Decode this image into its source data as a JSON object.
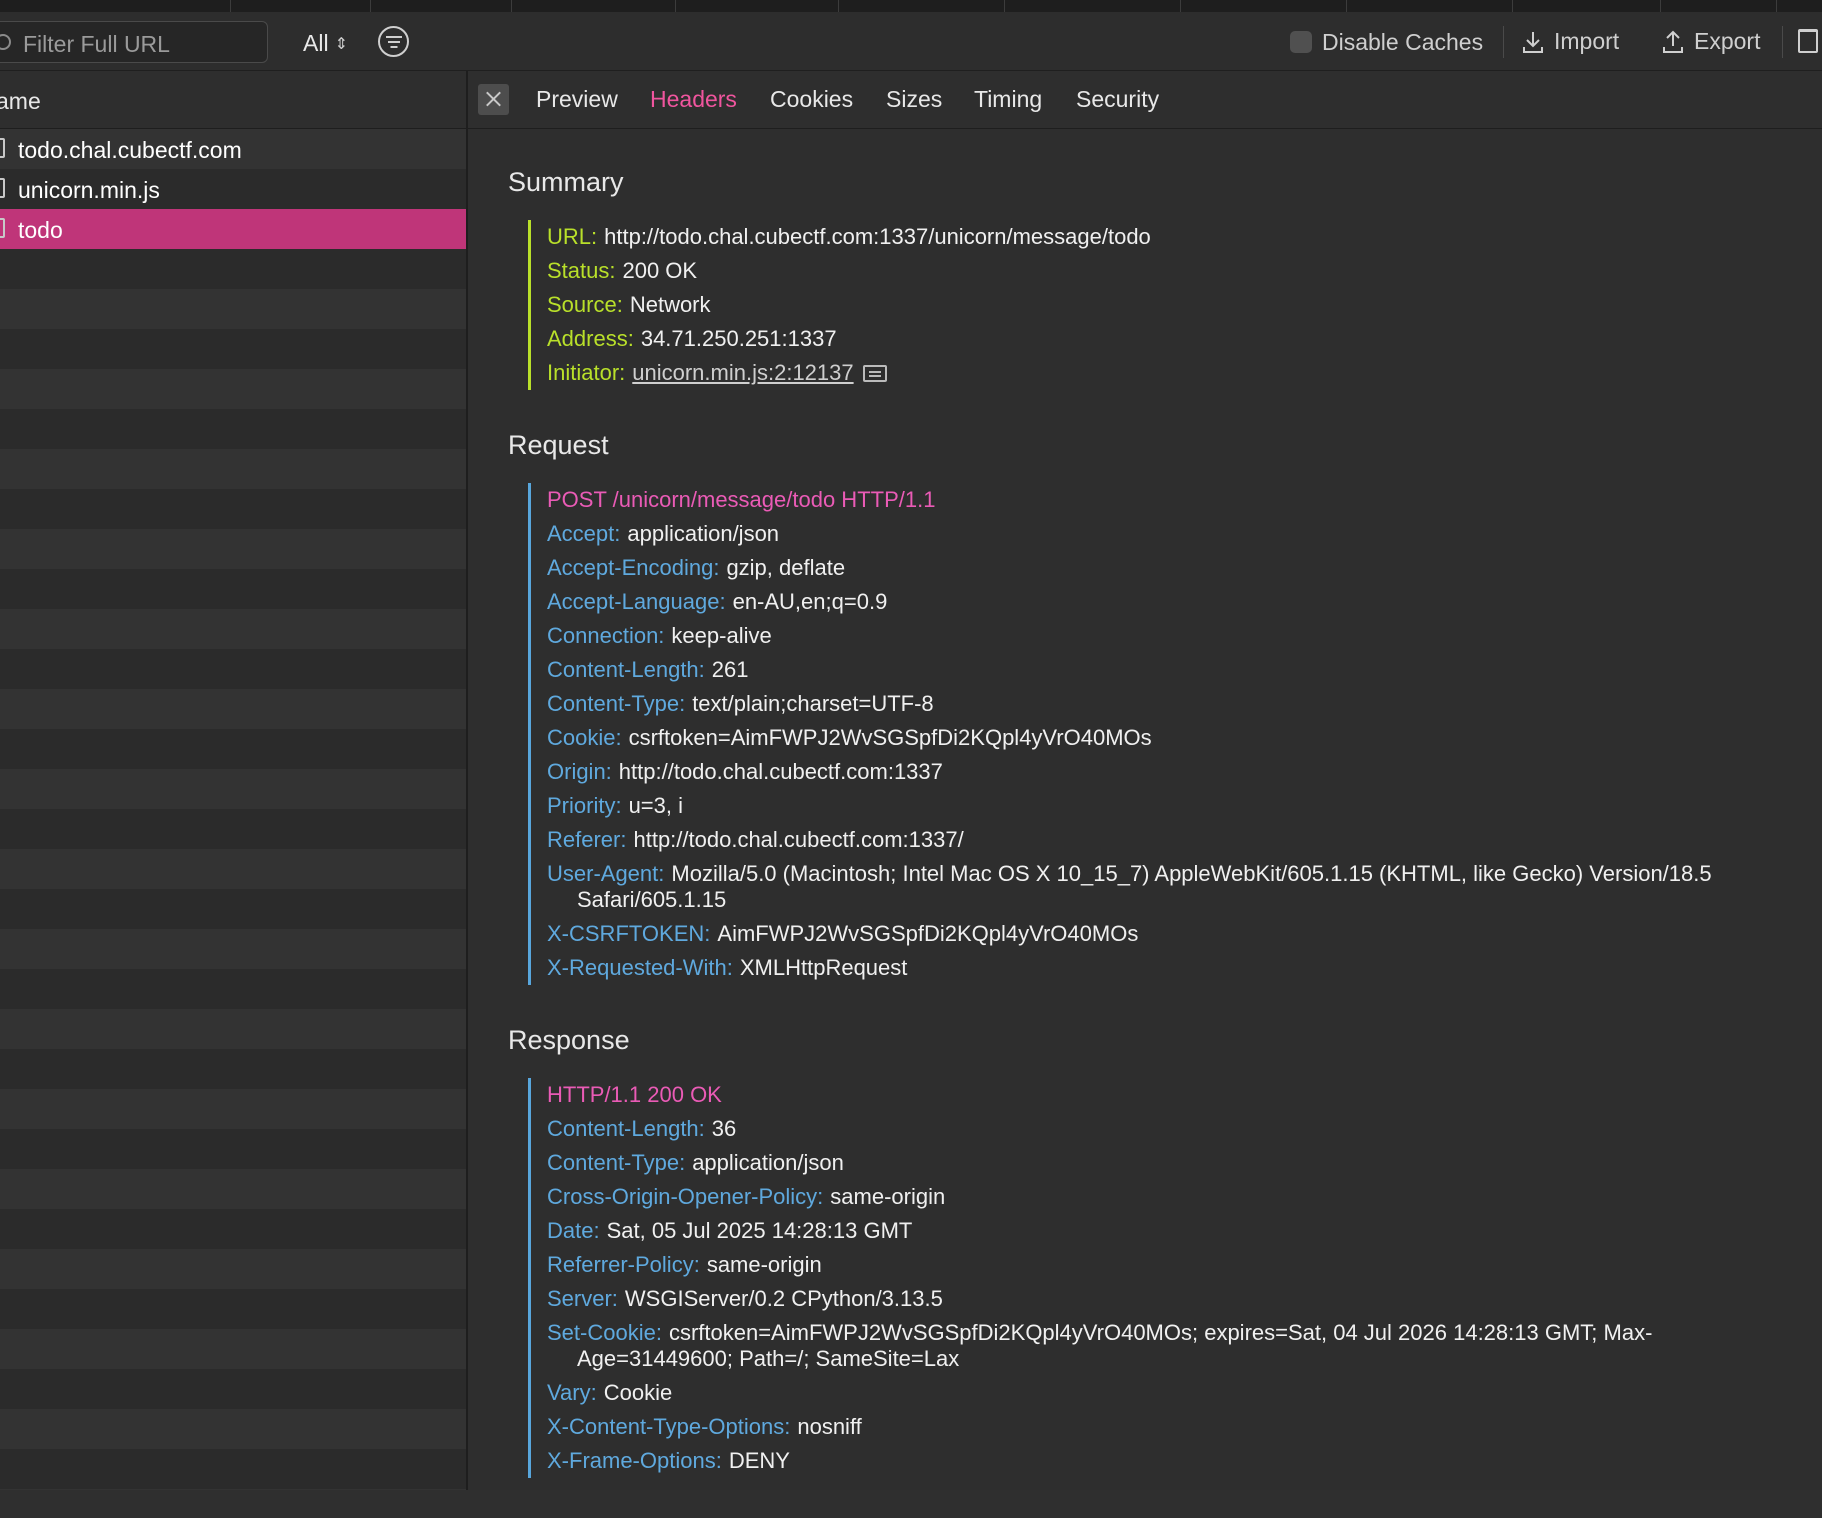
{
  "toolbar": {
    "filter_placeholder": "Filter Full URL",
    "type_select": "All",
    "disable_caches_label": "Disable Caches",
    "disable_caches_checked": false,
    "import_label": "Import",
    "export_label": "Export"
  },
  "list": {
    "header": "ame",
    "rows": [
      {
        "label": "todo.chal.cubectf.com",
        "selected": false
      },
      {
        "label": "unicorn.min.js",
        "selected": false
      },
      {
        "label": "todo",
        "selected": true
      }
    ]
  },
  "tabs": [
    "Preview",
    "Headers",
    "Cookies",
    "Sizes",
    "Timing",
    "Security"
  ],
  "active_tab": "Headers",
  "summary": {
    "title": "Summary",
    "url_key": "URL:",
    "url": "http://todo.chal.cubectf.com:1337/unicorn/message/todo",
    "status_key": "Status:",
    "status": "200 OK",
    "source_key": "Source:",
    "source": "Network",
    "address_key": "Address:",
    "address": "34.71.250.251:1337",
    "initiator_key": "Initiator:",
    "initiator": "unicorn.min.js:2:12137"
  },
  "request": {
    "title": "Request",
    "line": "POST /unicorn/message/todo HTTP/1.1",
    "headers": [
      {
        "key": "Accept:",
        "value": "application/json"
      },
      {
        "key": "Accept-Encoding:",
        "value": "gzip, deflate"
      },
      {
        "key": "Accept-Language:",
        "value": "en-AU,en;q=0.9"
      },
      {
        "key": "Connection:",
        "value": "keep-alive"
      },
      {
        "key": "Content-Length:",
        "value": "261"
      },
      {
        "key": "Content-Type:",
        "value": "text/plain;charset=UTF-8"
      },
      {
        "key": "Cookie:",
        "value": "csrftoken=AimFWPJ2WvSGSpfDi2KQpl4yVrO40MOs"
      },
      {
        "key": "Origin:",
        "value": "http://todo.chal.cubectf.com:1337"
      },
      {
        "key": "Priority:",
        "value": "u=3, i"
      },
      {
        "key": "Referer:",
        "value": "http://todo.chal.cubectf.com:1337/"
      },
      {
        "key": "User-Agent:",
        "value": "Mozilla/5.0 (Macintosh; Intel Mac OS X 10_15_7) AppleWebKit/605.1.15 (KHTML, like Gecko) Version/18.5 Safari/605.1.15"
      },
      {
        "key": "X-CSRFTOKEN:",
        "value": "AimFWPJ2WvSGSpfDi2KQpl4yVrO40MOs"
      },
      {
        "key": "X-Requested-With:",
        "value": "XMLHttpRequest"
      }
    ]
  },
  "response": {
    "title": "Response",
    "line": "HTTP/1.1 200 OK",
    "headers": [
      {
        "key": "Content-Length:",
        "value": "36"
      },
      {
        "key": "Content-Type:",
        "value": "application/json"
      },
      {
        "key": "Cross-Origin-Opener-Policy:",
        "value": "same-origin"
      },
      {
        "key": "Date:",
        "value": "Sat, 05 Jul 2025 14:28:13 GMT"
      },
      {
        "key": "Referrer-Policy:",
        "value": "same-origin"
      },
      {
        "key": "Server:",
        "value": "WSGIServer/0.2 CPython/3.13.5"
      },
      {
        "key": "Set-Cookie:",
        "value": "csrftoken=AimFWPJ2WvSGSpfDi2KQpl4yVrO40MOs; expires=Sat, 04 Jul 2026 14:28:13 GMT; Max-Age=31449600; Path=/; SameSite=Lax"
      },
      {
        "key": "Vary:",
        "value": "Cookie"
      },
      {
        "key": "X-Content-Type-Options:",
        "value": "nosniff"
      },
      {
        "key": "X-Frame-Options:",
        "value": "DENY"
      }
    ]
  },
  "colors": {
    "accent_pink": "#f0559e",
    "selected_row": "#bf3579",
    "summary_key": "#b9e02a",
    "header_key": "#5fa9de",
    "first_line": "#ea5bb6"
  },
  "icons": [
    "filter-search-icon",
    "chevron-updown-icon",
    "filter-icon",
    "import-icon",
    "export-icon",
    "trash-icon",
    "close-icon",
    "file-icon",
    "source-icon"
  ]
}
